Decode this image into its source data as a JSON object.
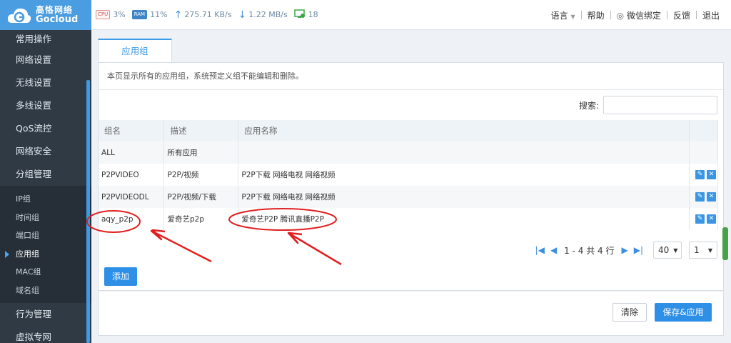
{
  "brand": {
    "cn": "高恪网络",
    "en": "Gocloud"
  },
  "topbar": {
    "cpu_chip": "CPU",
    "cpu": "3%",
    "ram_chip": "RAM",
    "ram": "11%",
    "upload": "275.71 KB/s",
    "download": "1.22 MB/s",
    "devices": "18",
    "links": {
      "language": "语言",
      "help": "帮助",
      "wechat": "微信绑定",
      "feedback": "反馈",
      "logout": "退出"
    }
  },
  "sidebar": {
    "items": [
      "常用操作",
      "网络设置",
      "无线设置",
      "多线设置",
      "QoS流控",
      "网络安全",
      "分组管理"
    ],
    "subitems": [
      "IP组",
      "时间组",
      "端口组",
      "应用组",
      "MAC组",
      "域名组"
    ],
    "active_sub": "应用组",
    "items_after": [
      "行为管理",
      "虚拟专网"
    ]
  },
  "page": {
    "tab": "应用组",
    "description": "本页显示所有的应用组，系统预定义组不能编辑和删除。",
    "search_label": "搜索:"
  },
  "table": {
    "headers": [
      "组名",
      "描述",
      "应用名称",
      ""
    ],
    "rows": [
      {
        "name": "ALL",
        "desc": "所有应用",
        "apps": "",
        "editable": false
      },
      {
        "name": "P2PVIDEO",
        "desc": "P2P/视频",
        "apps": "P2P下载 网络电视 网络视频",
        "editable": true
      },
      {
        "name": "P2PVIDEODL",
        "desc": "P2P/视频/下载",
        "apps": "P2P下载 网络电视 网络视频",
        "editable": true
      },
      {
        "name": "aqy_p2p",
        "desc": "爱奇艺p2p",
        "apps": "爱奇艺P2P 腾讯直播P2P",
        "editable": true
      }
    ]
  },
  "pagination": {
    "text": "1 - 4 共 4 行",
    "page_size": "40",
    "page": "1"
  },
  "buttons": {
    "add": "添加",
    "clear": "清除",
    "save": "保存&应用"
  },
  "colors": {
    "accent": "#2d8fe6",
    "sidebar": "#2f3a45",
    "annotation": "#e02020"
  }
}
